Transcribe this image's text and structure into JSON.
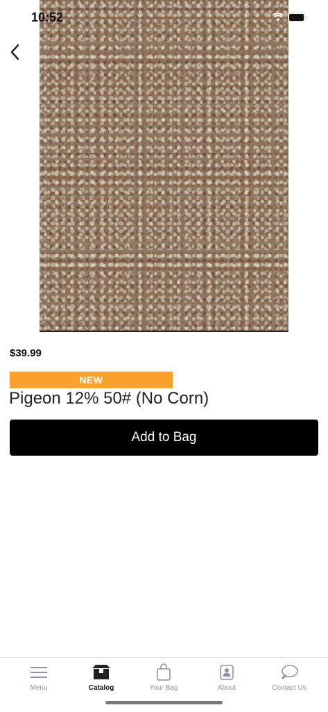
{
  "status_bar": {
    "time": "10:52"
  },
  "product": {
    "price": "$39.99",
    "badge": "NEW",
    "title": "Pigeon 12% 50# (No Corn)",
    "add_button_label": "Add to Bag"
  },
  "tabs": [
    {
      "label": "Menu",
      "icon": "menu-icon"
    },
    {
      "label": "Catalog",
      "icon": "catalog-icon",
      "active": true
    },
    {
      "label": "Your Bag",
      "icon": "bag-icon"
    },
    {
      "label": "About",
      "icon": "about-icon"
    },
    {
      "label": "Contact Us",
      "icon": "chat-icon"
    }
  ],
  "colors": {
    "badge": "#f8a22c",
    "button": "#000000",
    "tab_inactive": "#8a93a6",
    "tab_active": "#111111"
  }
}
